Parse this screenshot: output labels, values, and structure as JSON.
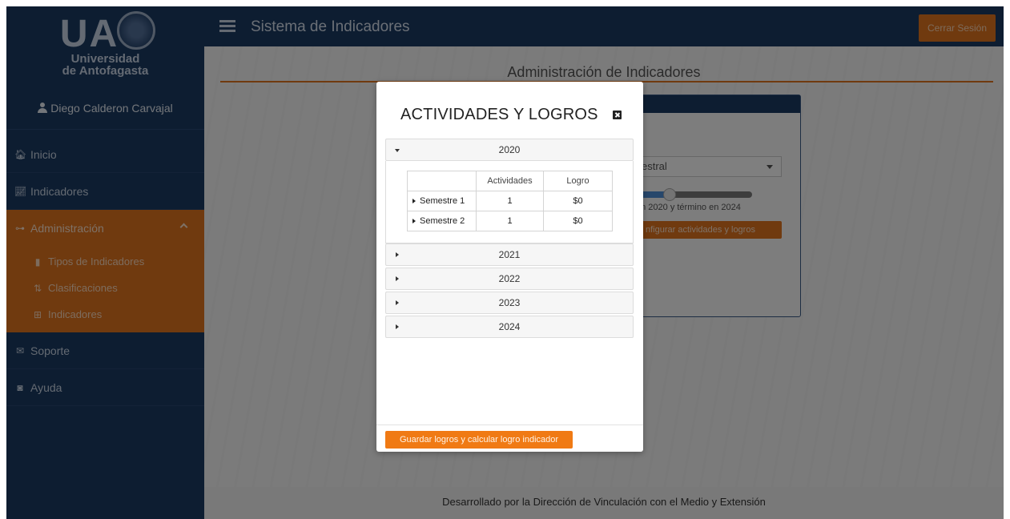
{
  "sidebar": {
    "logo_text": "UA",
    "logo_line1": "Universidad",
    "logo_line2": "de Antofagasta",
    "user_name": "Diego Calderon Carvajal",
    "nav": [
      {
        "label": "Inicio",
        "icon": "home-icon"
      },
      {
        "label": "Indicadores",
        "icon": "line-chart-icon"
      },
      {
        "label": "Administración",
        "icon": "sitemap-icon"
      }
    ],
    "subnav": [
      {
        "label": "Tipos de Indicadores",
        "icon": "file-icon"
      },
      {
        "label": "Clasificaciones",
        "icon": "sort-icon"
      },
      {
        "label": "Indicadores",
        "icon": "table-icon"
      }
    ],
    "nav_bottom": [
      {
        "label": "Soporte",
        "icon": "envelope-icon"
      },
      {
        "label": "Ayuda",
        "icon": "life-ring-icon"
      }
    ]
  },
  "header": {
    "title": "Sistema de Indicadores",
    "logout_label": "Cerrar Sesión"
  },
  "main": {
    "title": "Administración de Indicadores",
    "card": {
      "select_value": "estral",
      "range_text": "en 2020 y término en 2024",
      "button_label": "nfigurar actividades y logros"
    }
  },
  "footer": {
    "text": "Desarrollado por la Dirección de Vinculación con el Medio y Extensión"
  },
  "modal": {
    "title": "ACTIVIDADES Y LOGROS",
    "years": [
      {
        "year": "2020",
        "expanded": true,
        "columns": [
          "",
          "Actividades",
          "Logro"
        ],
        "rows": [
          {
            "label": "Semestre 1",
            "actividades": "1",
            "logro": "$0"
          },
          {
            "label": "Semestre 2",
            "actividades": "1",
            "logro": "$0"
          }
        ]
      },
      {
        "year": "2021",
        "expanded": false
      },
      {
        "year": "2022",
        "expanded": false
      },
      {
        "year": "2023",
        "expanded": false
      },
      {
        "year": "2024",
        "expanded": false
      }
    ],
    "save_label": "Guardar logros y calcular logro indicador"
  },
  "colors": {
    "navy": "#1b3a62",
    "orange": "#e0741f",
    "modal_button": "#f07a14"
  }
}
